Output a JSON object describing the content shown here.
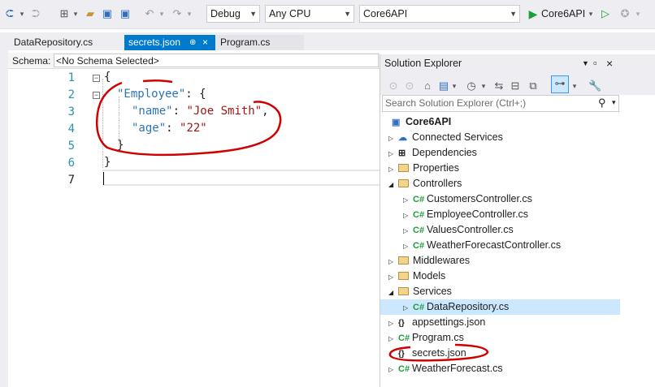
{
  "toolbar": {
    "config": "Debug",
    "platform": "Any CPU",
    "startup_project": "Core6API",
    "run_label": "Core6API"
  },
  "tabs": [
    {
      "label": "DataRepository.cs"
    },
    {
      "label": "secrets.json",
      "pin": "⊕",
      "close": "×"
    },
    {
      "label": "Program.cs"
    }
  ],
  "schema": {
    "label": "Schema:",
    "value": "<No Schema Selected>"
  },
  "editor": {
    "line_numbers": [
      "1",
      "2",
      "3",
      "4",
      "5",
      "6",
      "7"
    ],
    "json": {
      "key_employee": "\"Employee\"",
      "key_name": "\"name\"",
      "val_name": "\"Joe Smith\"",
      "key_age": "\"age\"",
      "val_age": "\"22\""
    }
  },
  "solution_explorer": {
    "title": "Solution Explorer",
    "search_placeholder": "Search Solution Explorer (Ctrl+;)",
    "root": "Core6API",
    "nodes": [
      {
        "label": "Connected Services"
      },
      {
        "label": "Dependencies"
      },
      {
        "label": "Properties"
      },
      {
        "label": "Controllers"
      },
      {
        "label": "CustomersController.cs"
      },
      {
        "label": "EmployeeController.cs"
      },
      {
        "label": "ValuesController.cs"
      },
      {
        "label": "WeatherForecastController.cs"
      },
      {
        "label": "Middlewares"
      },
      {
        "label": "Models"
      },
      {
        "label": "Services"
      },
      {
        "label": "DataRepository.cs"
      },
      {
        "label": "appsettings.json"
      },
      {
        "label": "Program.cs"
      },
      {
        "label": "secrets.json"
      },
      {
        "label": "WeatherForecast.cs"
      }
    ]
  },
  "colors": {
    "accent": "#007acc",
    "selected": "#cce8ff",
    "annotation": "#d00000"
  }
}
